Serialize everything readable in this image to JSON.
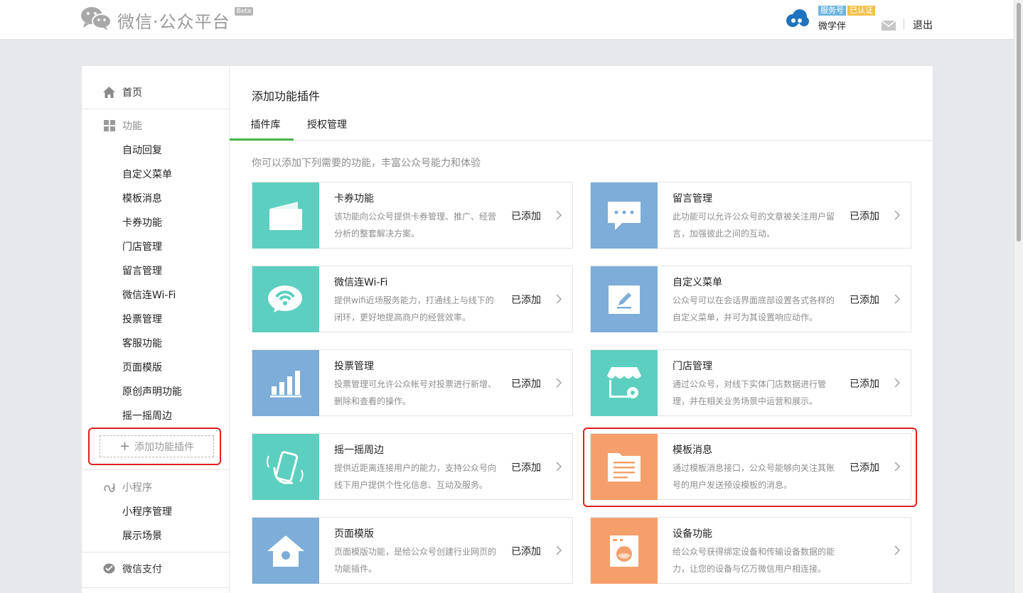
{
  "header": {
    "logo_text": "微信·公众平台",
    "beta": "Beta",
    "service_badge": "服务号",
    "verified_badge": "已认证",
    "account_name": "微学伴",
    "logout": "退出"
  },
  "sidebar": {
    "home": "首页",
    "functions_heading": "功能",
    "function_items": [
      "自动回复",
      "自定义菜单",
      "模板消息",
      "卡券功能",
      "门店管理",
      "留言管理",
      "微信连Wi-Fi",
      "投票管理",
      "客服功能",
      "页面模版",
      "原创声明功能",
      "摇一摇周边"
    ],
    "add_plugin": "添加功能插件",
    "miniprogram_heading": "小程序",
    "miniprogram_items": [
      "小程序管理",
      "展示场景"
    ],
    "pay_heading": "微信支付"
  },
  "content": {
    "title": "添加功能插件",
    "tabs": [
      "插件库",
      "授权管理"
    ],
    "intro": "你可以添加下列需要的功能，丰富公众号能力和体验"
  },
  "plugins": [
    {
      "name": "卡券功能",
      "desc": "该功能向公众号提供卡券管理、推广、经营分析的整套解决方案。",
      "status": "已添加",
      "icon": "card-wallet-icon",
      "color": "#5ccfc0"
    },
    {
      "name": "留言管理",
      "desc": "此功能可以允许公众号的文章被关注用户留言，加强彼此之间的互动。",
      "status": "已添加",
      "icon": "comment-bubble-icon",
      "color": "#7dadd8"
    },
    {
      "name": "微信连Wi-Fi",
      "desc": "提供wifi近场服务能力，打通线上与线下的闭环，更好地提高商户的经营效率。",
      "status": "已添加",
      "icon": "wifi-icon",
      "color": "#5ccfc0"
    },
    {
      "name": "自定义菜单",
      "desc": "公众号可以在会话界面底部设置各式各样的自定义菜单，并可为其设置响应动作。",
      "status": "已添加",
      "icon": "edit-pen-icon",
      "color": "#7dadd8"
    },
    {
      "name": "投票管理",
      "desc": "投票管理可允许公众帐号对投票进行新增、删除和查看的操作。",
      "status": "已添加",
      "icon": "bar-chart-icon",
      "color": "#7dadd8"
    },
    {
      "name": "门店管理",
      "desc": "通过公众号，对线下实体门店数据进行管理，并在相关业务场景中运营和展示。",
      "status": "已添加",
      "icon": "store-gear-icon",
      "color": "#5ccfc0"
    },
    {
      "name": "摇一摇周边",
      "desc": "提供近距离连接用户的能力，支持公众号向线下用户提供个性化信息、互动及服务。",
      "status": "已添加",
      "icon": "shake-phone-icon",
      "color": "#5ccfc0"
    },
    {
      "name": "模板消息",
      "desc": "通过模板消息接口，公众号能够向关注其账号的用户发送预设模板的消息。",
      "status": "已添加",
      "icon": "template-folder-icon",
      "color": "#f5a06c"
    },
    {
      "name": "页面模版",
      "desc": "页面模版功能，是给公众号创建行业网页的功能插件。",
      "status": "已添加",
      "icon": "house-icon",
      "color": "#7dadd8"
    },
    {
      "name": "设备功能",
      "desc": "给公众号获得绑定设备和传输设备数据的能力，让您的设备与亿万微信用户相连接。",
      "status": "",
      "icon": "washing-machine-icon",
      "color": "#f5a06c"
    }
  ]
}
